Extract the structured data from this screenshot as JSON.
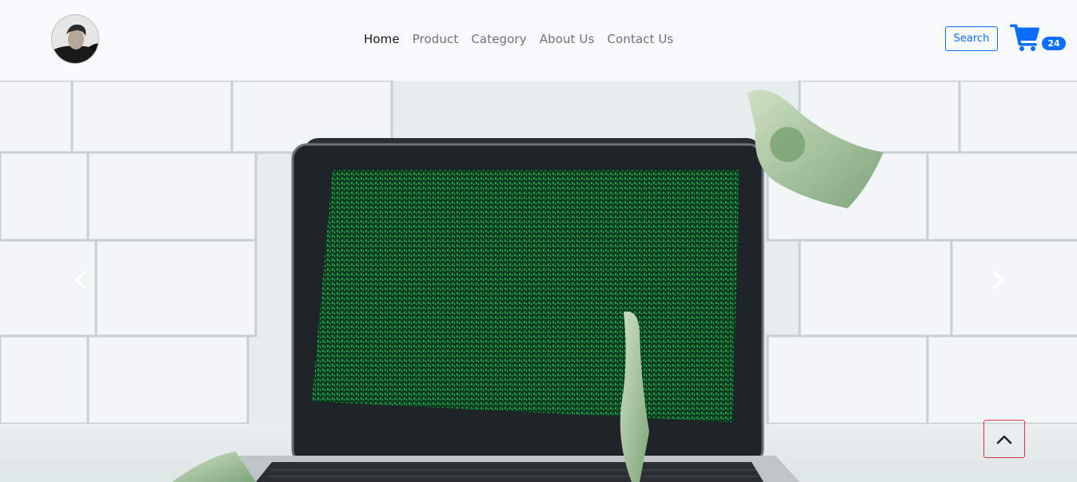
{
  "navbar": {
    "avatar_alt": "profile avatar",
    "links": [
      {
        "label": "Home",
        "active": true
      },
      {
        "label": "Product",
        "active": false
      },
      {
        "label": "Category",
        "active": false
      },
      {
        "label": "About Us",
        "active": false
      },
      {
        "label": "Contact Us",
        "active": false
      }
    ],
    "search_label": "Search",
    "cart_count": "24"
  },
  "hero": {
    "prev_icon": "chevron-left-icon",
    "next_icon": "chevron-right-icon"
  },
  "colors": {
    "primary": "#0d6efd",
    "danger": "#dc3545",
    "navbar_bg": "#f8f9fa"
  }
}
